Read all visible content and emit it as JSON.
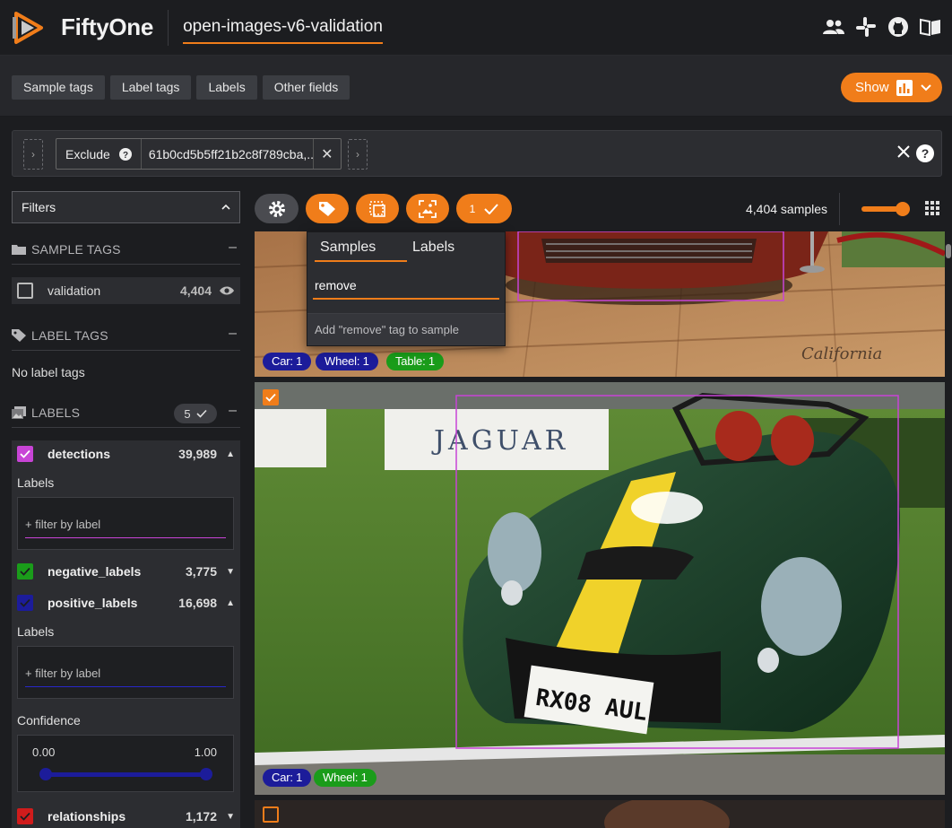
{
  "header": {
    "brand": "FiftyOne",
    "dataset": "open-images-v6-validation",
    "icons": [
      "users-icon",
      "slack-icon",
      "github-icon",
      "docs-book-icon"
    ]
  },
  "field_tabs": [
    "Sample tags",
    "Label tags",
    "Labels",
    "Other fields"
  ],
  "show_button": {
    "label": "Show"
  },
  "view_bar": {
    "stage_name": "Exclude",
    "stage_value": "61b0cd5b5ff21b2c8f789cba,..."
  },
  "sidebar": {
    "filters_select": "Filters",
    "sample_tags": {
      "title": "SAMPLE TAGS",
      "items": [
        {
          "label": "validation",
          "count": "4,404"
        }
      ]
    },
    "label_tags": {
      "title": "LABEL TAGS",
      "empty_text": "No label tags"
    },
    "labels": {
      "title": "LABELS",
      "selected_count": "5",
      "fields": [
        {
          "label": "detections",
          "count": "39,989",
          "color": "#c844d6",
          "checked": true
        },
        {
          "label": "negative_labels",
          "count": "3,775",
          "color": "#1a9c1a",
          "checked": true
        },
        {
          "label": "positive_labels",
          "count": "16,698",
          "color": "#1c1c9a",
          "checked": true
        },
        {
          "label": "relationships",
          "count": "1,172",
          "color": "#d01c1c",
          "checked": true
        }
      ],
      "labels_sublabel": "Labels",
      "filter_placeholder": "+ filter by label",
      "confidence_label": "Confidence",
      "confidence_min": "0.00",
      "confidence_max": "1.00"
    }
  },
  "grid": {
    "samples_count": "4,404 samples",
    "selected_count": "1",
    "tiles": [
      {
        "chips": [
          {
            "text": "Car: 1",
            "color": "#1c1c9a"
          },
          {
            "text": "Wheel: 1",
            "color": "#1c1c9a"
          },
          {
            "text": "Table: 1",
            "color": "#1a9c1a"
          }
        ]
      },
      {
        "chips": [
          {
            "text": "Car: 1",
            "color": "#1c1c9a"
          },
          {
            "text": "Wheel: 1",
            "color": "#1a9c1a"
          }
        ],
        "sign_text": "JAGUAR",
        "plate_text": "RX08 AUL",
        "checked": true
      },
      {
        "checked": false
      }
    ]
  },
  "tag_popover": {
    "tab_samples": "Samples",
    "tab_labels": "Labels",
    "input_value": "remove",
    "hint": "Add \"remove\" tag to sample"
  },
  "colors": {
    "accent": "#f07d1a",
    "bg": "#1c1d20",
    "panel": "#2c2d31"
  }
}
